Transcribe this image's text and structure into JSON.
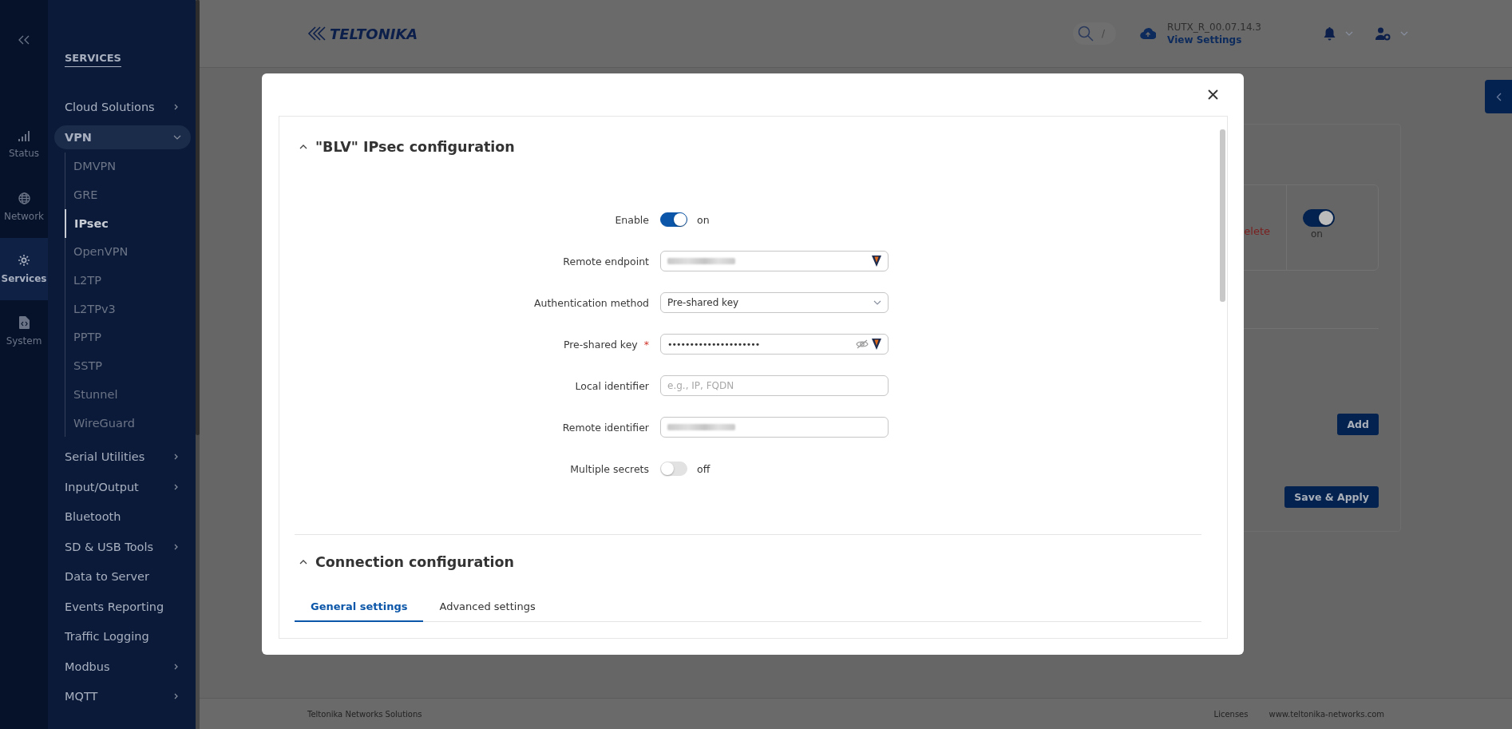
{
  "rail": {
    "items": [
      {
        "label": "Status",
        "kind": "signal",
        "selected": false
      },
      {
        "label": "Network",
        "kind": "globe",
        "selected": false
      },
      {
        "label": "Services",
        "kind": "gear",
        "selected": true
      },
      {
        "label": "System",
        "kind": "file",
        "selected": false
      }
    ]
  },
  "sidebar": {
    "heading": "SERVICES",
    "items": [
      {
        "label": "Cloud Solutions",
        "has_submenu": true,
        "expanded": false
      },
      {
        "label": "VPN",
        "has_submenu": true,
        "expanded": true,
        "children": [
          {
            "label": "DMVPN",
            "selected": false
          },
          {
            "label": "GRE",
            "selected": false
          },
          {
            "label": "IPsec",
            "selected": true
          },
          {
            "label": "OpenVPN",
            "selected": false
          },
          {
            "label": "L2TP",
            "selected": false
          },
          {
            "label": "L2TPv3",
            "selected": false
          },
          {
            "label": "PPTP",
            "selected": false
          },
          {
            "label": "SSTP",
            "selected": false
          },
          {
            "label": "Stunnel",
            "selected": false
          },
          {
            "label": "WireGuard",
            "selected": false
          }
        ]
      },
      {
        "label": "Serial Utilities",
        "has_submenu": true,
        "expanded": false
      },
      {
        "label": "Input/Output",
        "has_submenu": true,
        "expanded": false
      },
      {
        "label": "Bluetooth",
        "has_submenu": false,
        "expanded": false
      },
      {
        "label": "SD & USB Tools",
        "has_submenu": true,
        "expanded": false
      },
      {
        "label": "Data to Server",
        "has_submenu": false,
        "expanded": false
      },
      {
        "label": "Events Reporting",
        "has_submenu": false,
        "expanded": false
      },
      {
        "label": "Traffic Logging",
        "has_submenu": false,
        "expanded": false
      },
      {
        "label": "Modbus",
        "has_submenu": true,
        "expanded": false
      },
      {
        "label": "MQTT",
        "has_submenu": true,
        "expanded": false
      }
    ]
  },
  "header": {
    "logo": "TELTONIKA",
    "search_shortcut": "/",
    "firmware": "RUTX_R_00.07.14.3",
    "firmware_link": "View Settings"
  },
  "background": {
    "delete_text": "elete",
    "toggle": {
      "on": true,
      "state_text": "on"
    },
    "add_button": "Add",
    "save_button": "Save & Apply"
  },
  "modal": {
    "sections": [
      {
        "title": "\"BLV\" IPsec configuration",
        "expanded": true,
        "fields": [
          {
            "label": "Enable",
            "kind": "toggle",
            "on": true,
            "state_text": "on"
          },
          {
            "label": "Remote endpoint",
            "kind": "text",
            "redacted": true,
            "autofill_icon": true
          },
          {
            "label": "Authentication method",
            "kind": "select",
            "value": "Pre-shared key"
          },
          {
            "label": "Pre-shared key",
            "kind": "password",
            "required_mark": "*",
            "value": "•••••••••••••••••••••",
            "autofill_icon": true
          },
          {
            "label": "Local identifier",
            "kind": "text",
            "redacted": false,
            "autofill_icon": false,
            "placeholder": "e.g., IP, FQDN"
          },
          {
            "label": "Remote identifier",
            "kind": "text",
            "redacted": true,
            "autofill_icon": false
          },
          {
            "label": "Multiple secrets",
            "kind": "toggle",
            "on": false,
            "state_text": "off"
          }
        ]
      },
      {
        "title": "Connection configuration",
        "expanded": true,
        "tabs": [
          {
            "label": "General settings",
            "selected": true
          },
          {
            "label": "Advanced settings",
            "selected": false
          }
        ]
      }
    ]
  },
  "footer": {
    "company": "Teltonika Networks Solutions",
    "links": [
      "Licenses",
      "www.teltonika-networks.com"
    ]
  }
}
